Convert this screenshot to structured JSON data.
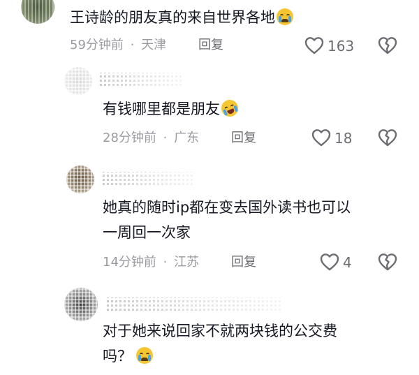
{
  "colors": {
    "text": "#161823",
    "meta": "#9a9ba0",
    "reply": "#6c6d72",
    "icon": "#6c6d72"
  },
  "comments": [
    {
      "text": "王诗龄的朋友真的来自世界各地",
      "emoji": "crying-face",
      "time": "59分钟前",
      "separator": "·",
      "location": "天津",
      "reply_label": "回复",
      "likes": "163"
    },
    {
      "text": "有钱哪里都是朋友",
      "emoji": "rolling-laughing-face",
      "time": "28分钟前",
      "separator": "·",
      "location": "广东",
      "reply_label": "回复",
      "likes": "18"
    },
    {
      "text_line1": "她真的随时ip都在变去国外读书也可以",
      "text_line2": "一周回一次家",
      "time": "14分钟前",
      "separator": "·",
      "location": "江苏",
      "reply_label": "回复",
      "likes": "4"
    },
    {
      "text_line1": "对于她来说回家不就两块钱的公交费",
      "text_line2": "吗？",
      "emoji": "crying-face"
    }
  ]
}
